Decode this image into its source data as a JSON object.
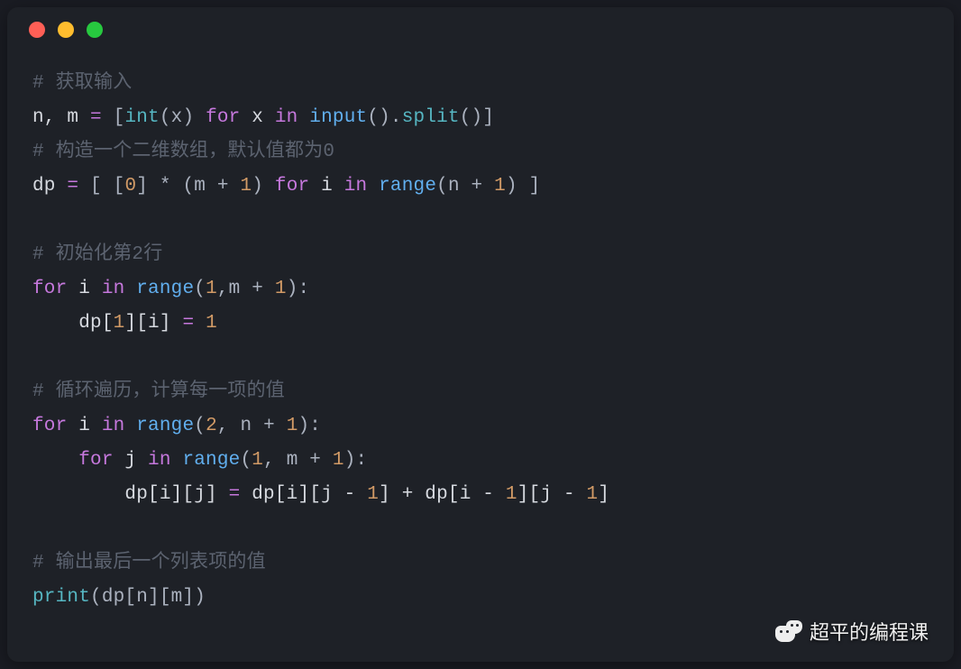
{
  "window": {
    "traffic_lights": [
      "red",
      "yellow",
      "green"
    ]
  },
  "code": {
    "c1": "# 获取输入",
    "l2_a": "n, m ",
    "l2_eq": "=",
    "l2_b": " [",
    "l2_int": "int",
    "l2_c": "(x) ",
    "l2_for": "for",
    "l2_d": " x ",
    "l2_in": "in",
    "l2_e": " ",
    "l2_input": "input",
    "l2_f": "().",
    "l2_split": "split",
    "l2_g": "()]",
    "c2": "# 构造一个二维数组，默认值都为0",
    "l4_a": "dp ",
    "l4_eq": "=",
    "l4_b": " [ [",
    "l4_zero": "0",
    "l4_c": "] * (m + ",
    "l4_one": "1",
    "l4_d": ") ",
    "l4_for": "for",
    "l4_e": " i ",
    "l4_in": "in",
    "l4_f": " ",
    "l4_range": "range",
    "l4_g": "(n + ",
    "l4_one2": "1",
    "l4_h": ") ]",
    "c3": "# 初始化第2行",
    "l7_for": "for",
    "l7_a": " i ",
    "l7_in": "in",
    "l7_b": " ",
    "l7_range": "range",
    "l7_c": "(",
    "l7_one": "1",
    "l7_d": ",m + ",
    "l7_one2": "1",
    "l7_e": "):",
    "l8_pad": "    ",
    "l8_a": "dp[",
    "l8_one": "1",
    "l8_b": "][i] ",
    "l8_eq": "=",
    "l8_c": " ",
    "l8_one2": "1",
    "c4": "# 循环遍历，计算每一项的值",
    "l11_for": "for",
    "l11_a": " i ",
    "l11_in": "in",
    "l11_b": " ",
    "l11_range": "range",
    "l11_c": "(",
    "l11_two": "2",
    "l11_d": ", n + ",
    "l11_one": "1",
    "l11_e": "):",
    "l12_pad": "    ",
    "l12_for": "for",
    "l12_a": " j ",
    "l12_in": "in",
    "l12_b": " ",
    "l12_range": "range",
    "l12_c": "(",
    "l12_one": "1",
    "l12_d": ", m + ",
    "l12_one2": "1",
    "l12_e": "):",
    "l13_pad": "        ",
    "l13_a": "dp[i][j] ",
    "l13_eq": "=",
    "l13_b": " dp[i][j - ",
    "l13_one": "1",
    "l13_c": "] + dp[i - ",
    "l13_one2": "1",
    "l13_d": "][j - ",
    "l13_one3": "1",
    "l13_e": "]",
    "c5": "# 输出最后一个列表项的值",
    "l16_print": "print",
    "l16_a": "(dp[n][m])"
  },
  "watermark": {
    "text": "超平的编程课"
  }
}
